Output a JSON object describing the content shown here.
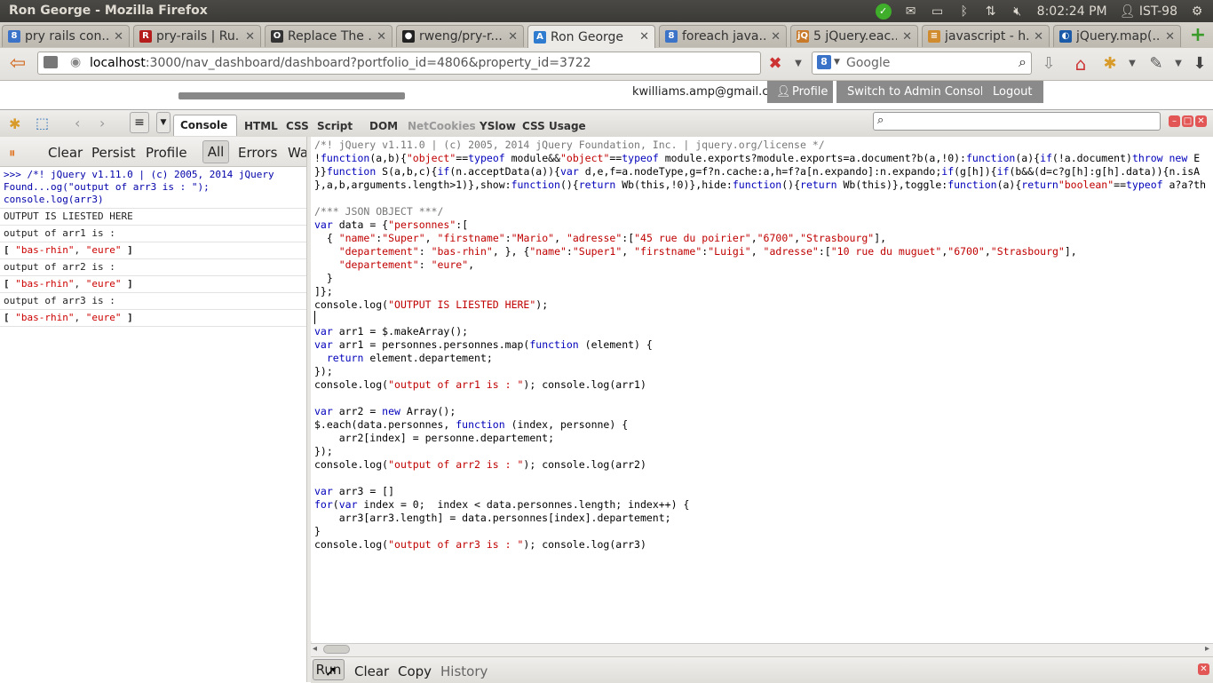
{
  "window": {
    "title": "Ron George - Mozilla Firefox"
  },
  "tray": {
    "clock": "8:02:24 PM",
    "user": "IST-98"
  },
  "tabs": [
    {
      "label": "pry rails con...",
      "fav_color": "#3b73c8",
      "fav_text": "8"
    },
    {
      "label": "pry-rails | Ru...",
      "fav_color": "#b51d1d",
      "fav_text": "R"
    },
    {
      "label": "Replace The ...",
      "fav_color": "#333333",
      "fav_text": "O"
    },
    {
      "label": "rweng/pry-r...",
      "fav_color": "#222222",
      "fav_text": "●"
    },
    {
      "label": "Ron George",
      "fav_color": "#2f7bd0",
      "fav_text": "A",
      "active": true
    },
    {
      "label": "foreach java...",
      "fav_color": "#3b73c8",
      "fav_text": "8"
    },
    {
      "label": "5 jQuery.eac...",
      "fav_color": "#c87a2a",
      "fav_text": "jQ"
    },
    {
      "label": "javascript - h...",
      "fav_color": "#d08b2e",
      "fav_text": "≡"
    },
    {
      "label": "jQuery.map(...",
      "fav_color": "#1a5aa8",
      "fav_text": "◐"
    }
  ],
  "nav": {
    "url_host": "localhost",
    "url_rest": ":3000/nav_dashboard/dashboard?portfolio_id=4806&property_id=3722",
    "search_placeholder": "Google"
  },
  "page": {
    "user_email": "kwilliams.amp@gmail.com",
    "profile_label": "Profile",
    "admin_label": "Switch to Admin Console",
    "logout_label": "Logout"
  },
  "firebug": {
    "console_tab": "Console",
    "tabs": [
      "HTML",
      "CSS",
      "Script",
      "DOM",
      "Net",
      "Cookies",
      "YSlow",
      "CSS Usage"
    ],
    "dim_tabs": [
      "Net",
      "Cookies"
    ],
    "console_buttons": {
      "clear": "Clear",
      "persist": "Persist",
      "profile": "Profile",
      "all": "All",
      "errors": "Errors",
      "warnings": "Wa"
    },
    "bottom": {
      "run": "Run",
      "clear": "Clear",
      "copy": "Copy",
      "history": "History"
    }
  },
  "log": {
    "command": [
      ">>> /*! jQuery v1.11.0 | (c) 2005, 2014 jQuery",
      "Found...og(\"output of arr3 is : \");",
      "console.log(arr3)"
    ],
    "rows": [
      {
        "type": "text",
        "text": "OUTPUT IS LIESTED HERE"
      },
      {
        "type": "text",
        "text": "output of arr1 is :"
      },
      {
        "type": "array",
        "items": [
          "\"bas-rhin\"",
          "\"eure\""
        ]
      },
      {
        "type": "text",
        "text": "output of arr2 is :"
      },
      {
        "type": "array",
        "items": [
          "\"bas-rhin\"",
          "\"eure\""
        ]
      },
      {
        "type": "text",
        "text": "output of arr3 is :"
      },
      {
        "type": "array",
        "items": [
          "\"bas-rhin\"",
          "\"eure\""
        ]
      }
    ]
  },
  "code_lines": [
    "/*! jQuery v1.11.0 | (c) 2005, 2014 jQuery Foundation, Inc. | jquery.org/license */",
    "!function(a,b){\"object\"==typeof module&&\"object\"==typeof module.exports?module.exports=a.document?b(a,!0):function(a){if(!a.document)throw new E",
    "}}function S(a,b,c){if(n.acceptData(a)){var d,e,f=a.nodeType,g=f?n.cache:a,h=f?a[n.expando]:n.expando;if(g[h]){if(b&&(d=c?g[h]:g[h].data)){n.isA",
    "},a,b,arguments.length>1)},show:function(){return Wb(this,!0)},hide:function(){return Wb(this)},toggle:function(a){return\"boolean\"==typeof a?a?th",
    "",
    "/*** JSON OBJECT ***/",
    "var data = {\"personnes\":[",
    "  { \"name\":\"Super\", \"firstname\":\"Mario\", \"adresse\":[\"45 rue du poirier\",\"6700\",\"Strasbourg\"],",
    "    \"departement\": \"bas-rhin\", }, {\"name\":\"Super1\", \"firstname\":\"Luigi\", \"adresse\":[\"10 rue du muguet\",\"6700\",\"Strasbourg\"],",
    "    \"departement\": \"eure\",",
    "  }",
    "]};",
    "console.log(\"OUTPUT IS LIESTED HERE\");",
    "",
    "var arr1 = $.makeArray();",
    "var arr1 = personnes.personnes.map(function (element) {",
    "  return element.departement;",
    "});",
    "console.log(\"output of arr1 is : \"); console.log(arr1)",
    "",
    "var arr2 = new Array();",
    "$.each(data.personnes, function (index, personne) {",
    "    arr2[index] = personne.departement;",
    "});",
    "console.log(\"output of arr2 is : \"); console.log(arr2)",
    "",
    "var arr3 = []",
    "for(var index = 0;  index < data.personnes.length; index++) {",
    "    arr3[arr3.length] = data.personnes[index].departement;",
    "}",
    "console.log(\"output of arr3 is : \"); console.log(arr3)"
  ]
}
